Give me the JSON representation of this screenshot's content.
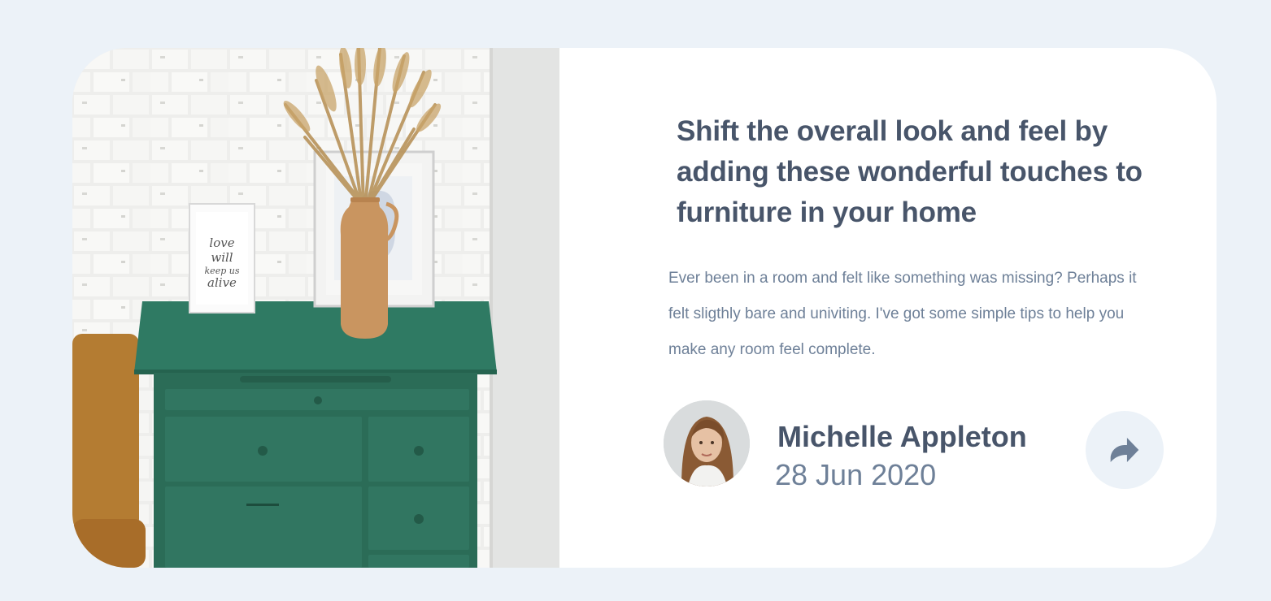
{
  "article": {
    "image_alt": "Green drawer cabinet with a vase of dried grass and framed prints against a white brick wall",
    "frame_text": "love will keep us alive",
    "headline": "Shift the overall look and feel by adding these wonderful touches to furniture in your home",
    "excerpt": "Ever been in a room and felt like something was missing? Perhaps it felt sligthly bare and univiting. I've got some simple tips to help you make any room feel complete."
  },
  "author": {
    "name": "Michelle Appleton",
    "date": "28 Jun 2020",
    "avatar_icon": "author-avatar"
  },
  "share": {
    "icon": "share-arrow-icon"
  },
  "colors": {
    "background": "#ecf2f8",
    "card": "#ffffff",
    "heading": "#48556a",
    "body_text": "#6e8098",
    "cabinet_green": "#2f6f5a"
  }
}
